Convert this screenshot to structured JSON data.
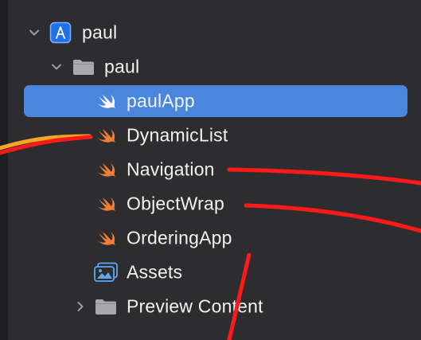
{
  "navigator": {
    "project": {
      "label": "paul",
      "icon": "xcode-project-icon",
      "expanded": true
    },
    "group": {
      "label": "paul",
      "icon": "folder-icon",
      "expanded": true
    },
    "files": [
      {
        "label": "paulApp",
        "icon": "swift-file-icon",
        "selected": true
      },
      {
        "label": "DynamicList",
        "icon": "swift-file-icon",
        "selected": false
      },
      {
        "label": "Navigation",
        "icon": "swift-file-icon",
        "selected": false
      },
      {
        "label": "ObjectWrap",
        "icon": "swift-file-icon",
        "selected": false
      },
      {
        "label": "OrderingApp",
        "icon": "swift-file-icon",
        "selected": false
      },
      {
        "label": "Assets",
        "icon": "asset-catalog-icon",
        "selected": false
      }
    ],
    "preview_folder": {
      "label": "Preview Content",
      "icon": "folder-icon",
      "expanded": false
    }
  },
  "colors": {
    "selection": "#4a86de",
    "swift_orange": "#f07c35",
    "annotation_red": "#ff1a1a",
    "annotation_orange": "#f5a623",
    "folder_gray": "#a9a9ad",
    "project_blue": "#2f7cf6"
  }
}
